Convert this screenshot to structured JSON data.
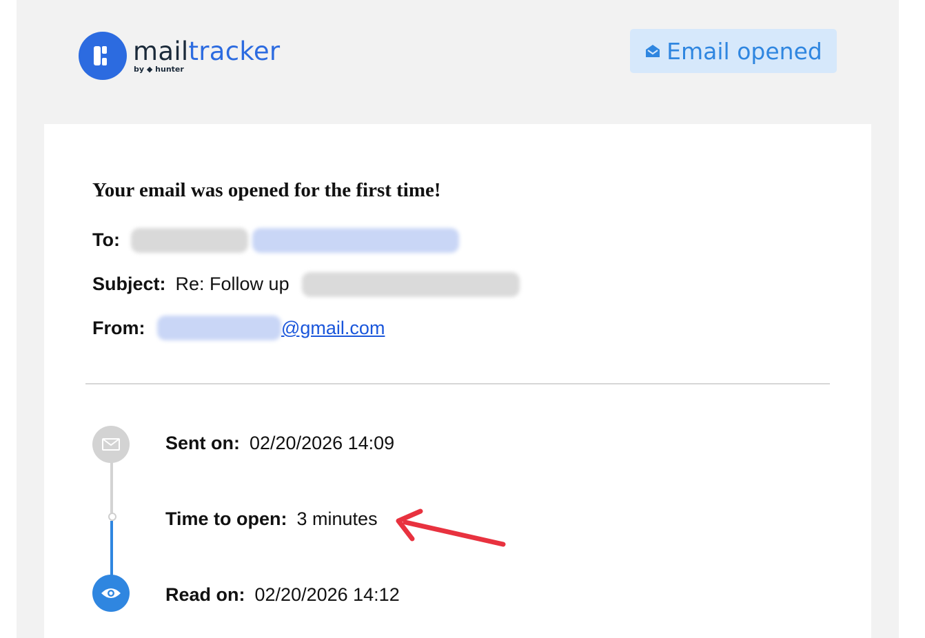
{
  "header": {
    "logo_name_primary": "mail",
    "logo_name_accent": "tracker",
    "logo_byline": "by ◆ hunter",
    "status_badge": "Email opened"
  },
  "email": {
    "heading": "Your email was opened for the first time!",
    "to_label": "To:",
    "subject_label": "Subject:",
    "subject_value": "Re: Follow up",
    "from_label": "From:",
    "from_visible": "@gmail.com"
  },
  "timeline": {
    "sent_label": "Sent on:",
    "sent_value": "02/20/2026 14:09",
    "time_to_open_label": "Time to open:",
    "time_to_open_value": "3 minutes",
    "read_label": "Read on:",
    "read_value": "02/20/2026 14:12"
  },
  "colors": {
    "brand_blue": "#2c6be0",
    "badge_bg": "#d6e8fb",
    "badge_text": "#2f86e0",
    "annotation_arrow": "#e8323f"
  },
  "icons": [
    "mailtracker-logo-icon",
    "envelope-open-icon",
    "envelope-icon",
    "eye-icon",
    "annotation-arrow-icon"
  ]
}
